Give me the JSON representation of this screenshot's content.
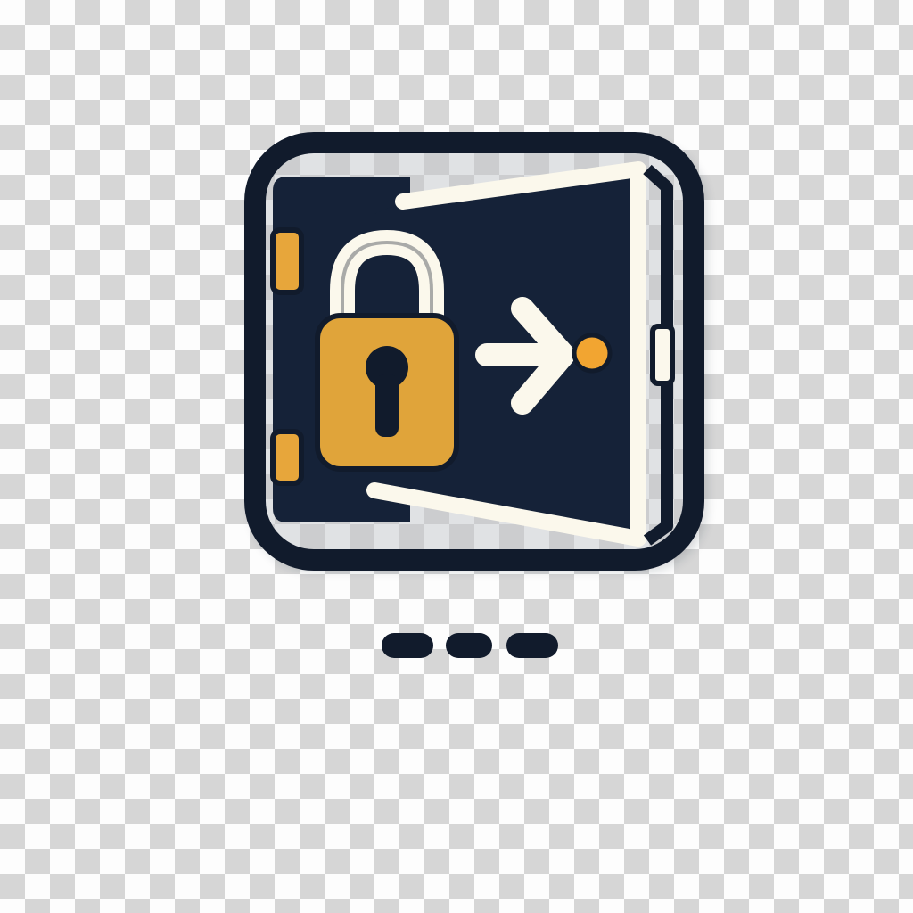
{
  "icon": {
    "name": "secure-login-door-icon",
    "parts": [
      "rounded-frame",
      "open-door",
      "padlock-icon",
      "keyhole",
      "arrow-right-icon",
      "door-knob",
      "hinge"
    ]
  },
  "colors": {
    "frame": "#111b2c",
    "door_panel": "#152238",
    "door_outline": "#fbf8ec",
    "padlock_body": "#e0a43a",
    "padlock_shackle": "#fbf8ec",
    "keyhole": "#111b2c",
    "arrow": "#fbf8ec",
    "knob": "#f2a531",
    "hinge": "#e7a63b",
    "dots": "#111b2c"
  },
  "indicator": {
    "name": "ellipsis-dots",
    "count": 3
  }
}
